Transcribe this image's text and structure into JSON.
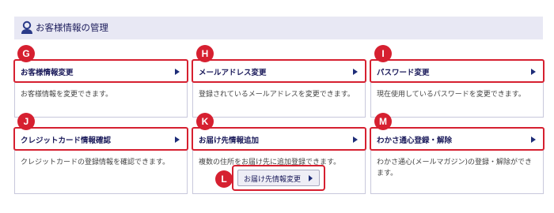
{
  "header": {
    "title": "お客様情報の管理",
    "icon": "user-icon"
  },
  "cards": [
    {
      "badge": "G",
      "title": "お客様情報変更",
      "desc": "お客様情報を変更できます。"
    },
    {
      "badge": "H",
      "title": "メールアドレス変更",
      "desc": "登録されているメールアドレスを変更できます。"
    },
    {
      "badge": "I",
      "title": "パスワード変更",
      "desc": "現在使用しているパスワードを変更できます。"
    },
    {
      "badge": "J",
      "title": "クレジットカード情報確認",
      "desc": "クレジットカードの登録情報を確認できます。"
    },
    {
      "badge": "K",
      "title": "お届け先情報追加",
      "desc": "複数の住所をお届け先に追加登録できます。"
    },
    {
      "badge": "M",
      "title": "わかさ通心登録・解除",
      "desc": "わかさ通心(メールマガジン)の登録・解除ができます。"
    }
  ],
  "extra_button": {
    "badge": "L",
    "label": "お届け先情報変更"
  },
  "colors": {
    "accent": "#d62030",
    "navy": "#1a1a5a",
    "header_bg": "#e8e8f4"
  }
}
